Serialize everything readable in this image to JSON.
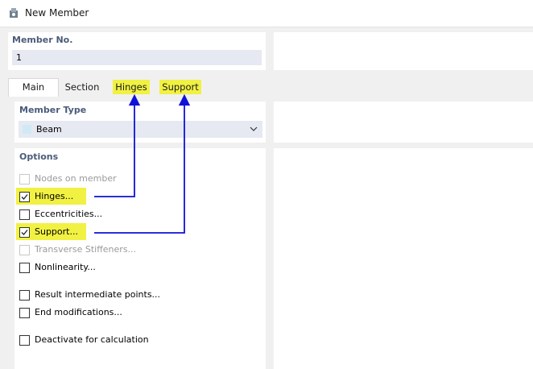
{
  "window": {
    "title": "New Member"
  },
  "member_no": {
    "label": "Member No.",
    "value": "1"
  },
  "tabs": [
    {
      "label": "Main",
      "active": true,
      "highlight": false
    },
    {
      "label": "Section",
      "active": false,
      "highlight": false
    },
    {
      "label": "Hinges",
      "active": false,
      "highlight": true
    },
    {
      "label": "Support",
      "active": false,
      "highlight": true
    }
  ],
  "member_type": {
    "label": "Member Type",
    "value": "Beam",
    "swatch_color": "#cfeaf4"
  },
  "options": {
    "label": "Options",
    "items": [
      {
        "label": "Nodes on member",
        "checked": false,
        "disabled": true,
        "highlight": false
      },
      {
        "label": "Hinges...",
        "checked": true,
        "disabled": false,
        "highlight": true
      },
      {
        "label": "Eccentricities...",
        "checked": false,
        "disabled": false,
        "highlight": false
      },
      {
        "label": "Support...",
        "checked": true,
        "disabled": false,
        "highlight": true
      },
      {
        "label": "Transverse Stiffeners...",
        "checked": false,
        "disabled": true,
        "highlight": false
      },
      {
        "label": "Nonlinearity...",
        "checked": false,
        "disabled": false,
        "highlight": false
      },
      {
        "label": "Result intermediate points...",
        "checked": false,
        "disabled": false,
        "highlight": false
      },
      {
        "label": "End modifications...",
        "checked": false,
        "disabled": false,
        "highlight": false
      },
      {
        "label": "Deactivate for calculation",
        "checked": false,
        "disabled": false,
        "highlight": false
      }
    ]
  },
  "colors": {
    "highlight": "#f1f143",
    "arrow": "#1010d8",
    "label": "#4a5b7a",
    "field": "#e6e9f2"
  }
}
